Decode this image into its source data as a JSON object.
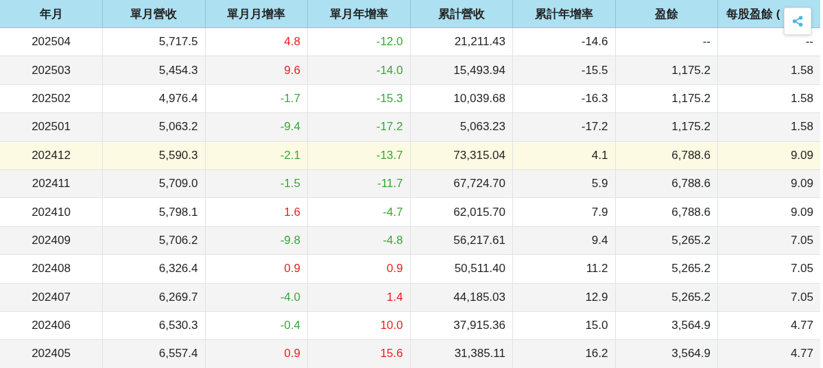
{
  "table": {
    "columns": [
      "年月",
      "單月營收",
      "單月月增率",
      "單月年增率",
      "累計營收",
      "累計年增率",
      "盈餘",
      "每股盈餘 ("
    ],
    "rows": [
      {
        "highlighted": false,
        "cells": [
          {
            "text": "202504"
          },
          {
            "text": "5,717.5"
          },
          {
            "text": "4.8",
            "color": "#ee1c1c"
          },
          {
            "text": "-12.0",
            "color": "#3aa63a"
          },
          {
            "text": "21,211.43"
          },
          {
            "text": "-14.6"
          },
          {
            "text": "--"
          },
          {
            "text": "--"
          }
        ]
      },
      {
        "highlighted": false,
        "cells": [
          {
            "text": "202503"
          },
          {
            "text": "5,454.3"
          },
          {
            "text": "9.6",
            "color": "#ee1c1c"
          },
          {
            "text": "-14.0",
            "color": "#3aa63a"
          },
          {
            "text": "15,493.94"
          },
          {
            "text": "-15.5"
          },
          {
            "text": "1,175.2"
          },
          {
            "text": "1.58"
          }
        ]
      },
      {
        "highlighted": false,
        "cells": [
          {
            "text": "202502"
          },
          {
            "text": "4,976.4"
          },
          {
            "text": "-1.7",
            "color": "#3aa63a"
          },
          {
            "text": "-15.3",
            "color": "#3aa63a"
          },
          {
            "text": "10,039.68"
          },
          {
            "text": "-16.3"
          },
          {
            "text": "1,175.2"
          },
          {
            "text": "1.58"
          }
        ]
      },
      {
        "highlighted": false,
        "cells": [
          {
            "text": "202501"
          },
          {
            "text": "5,063.2"
          },
          {
            "text": "-9.4",
            "color": "#3aa63a"
          },
          {
            "text": "-17.2",
            "color": "#3aa63a"
          },
          {
            "text": "5,063.23"
          },
          {
            "text": "-17.2"
          },
          {
            "text": "1,175.2"
          },
          {
            "text": "1.58"
          }
        ]
      },
      {
        "highlighted": true,
        "cells": [
          {
            "text": "202412"
          },
          {
            "text": "5,590.3"
          },
          {
            "text": "-2.1",
            "color": "#3aa63a"
          },
          {
            "text": "-13.7",
            "color": "#3aa63a"
          },
          {
            "text": "73,315.04"
          },
          {
            "text": "4.1"
          },
          {
            "text": "6,788.6"
          },
          {
            "text": "9.09"
          }
        ]
      },
      {
        "highlighted": false,
        "cells": [
          {
            "text": "202411"
          },
          {
            "text": "5,709.0"
          },
          {
            "text": "-1.5",
            "color": "#3aa63a"
          },
          {
            "text": "-11.7",
            "color": "#3aa63a"
          },
          {
            "text": "67,724.70"
          },
          {
            "text": "5.9"
          },
          {
            "text": "6,788.6"
          },
          {
            "text": "9.09"
          }
        ]
      },
      {
        "highlighted": false,
        "cells": [
          {
            "text": "202410"
          },
          {
            "text": "5,798.1"
          },
          {
            "text": "1.6",
            "color": "#ee1c1c"
          },
          {
            "text": "-4.7",
            "color": "#3aa63a"
          },
          {
            "text": "62,015.70"
          },
          {
            "text": "7.9"
          },
          {
            "text": "6,788.6"
          },
          {
            "text": "9.09"
          }
        ]
      },
      {
        "highlighted": false,
        "cells": [
          {
            "text": "202409"
          },
          {
            "text": "5,706.2"
          },
          {
            "text": "-9.8",
            "color": "#3aa63a"
          },
          {
            "text": "-4.8",
            "color": "#3aa63a"
          },
          {
            "text": "56,217.61"
          },
          {
            "text": "9.4"
          },
          {
            "text": "5,265.2"
          },
          {
            "text": "7.05"
          }
        ]
      },
      {
        "highlighted": false,
        "cells": [
          {
            "text": "202408"
          },
          {
            "text": "6,326.4"
          },
          {
            "text": "0.9",
            "color": "#ee1c1c"
          },
          {
            "text": "0.9",
            "color": "#ee1c1c"
          },
          {
            "text": "50,511.40"
          },
          {
            "text": "11.2"
          },
          {
            "text": "5,265.2"
          },
          {
            "text": "7.05"
          }
        ]
      },
      {
        "highlighted": false,
        "cells": [
          {
            "text": "202407"
          },
          {
            "text": "6,269.7"
          },
          {
            "text": "-4.0",
            "color": "#3aa63a"
          },
          {
            "text": "1.4",
            "color": "#ee1c1c"
          },
          {
            "text": "44,185.03"
          },
          {
            "text": "12.9"
          },
          {
            "text": "5,265.2"
          },
          {
            "text": "7.05"
          }
        ]
      },
      {
        "highlighted": false,
        "cells": [
          {
            "text": "202406"
          },
          {
            "text": "6,530.3"
          },
          {
            "text": "-0.4",
            "color": "#3aa63a"
          },
          {
            "text": "10.0",
            "color": "#ee1c1c"
          },
          {
            "text": "37,915.36"
          },
          {
            "text": "15.0"
          },
          {
            "text": "3,564.9"
          },
          {
            "text": "4.77"
          }
        ]
      },
      {
        "highlighted": false,
        "cells": [
          {
            "text": "202405"
          },
          {
            "text": "6,557.4"
          },
          {
            "text": "0.9",
            "color": "#ee1c1c"
          },
          {
            "text": "15.6",
            "color": "#ee1c1c"
          },
          {
            "text": "31,385.11"
          },
          {
            "text": "16.2"
          },
          {
            "text": "3,564.9"
          },
          {
            "text": "4.77"
          }
        ]
      }
    ]
  }
}
